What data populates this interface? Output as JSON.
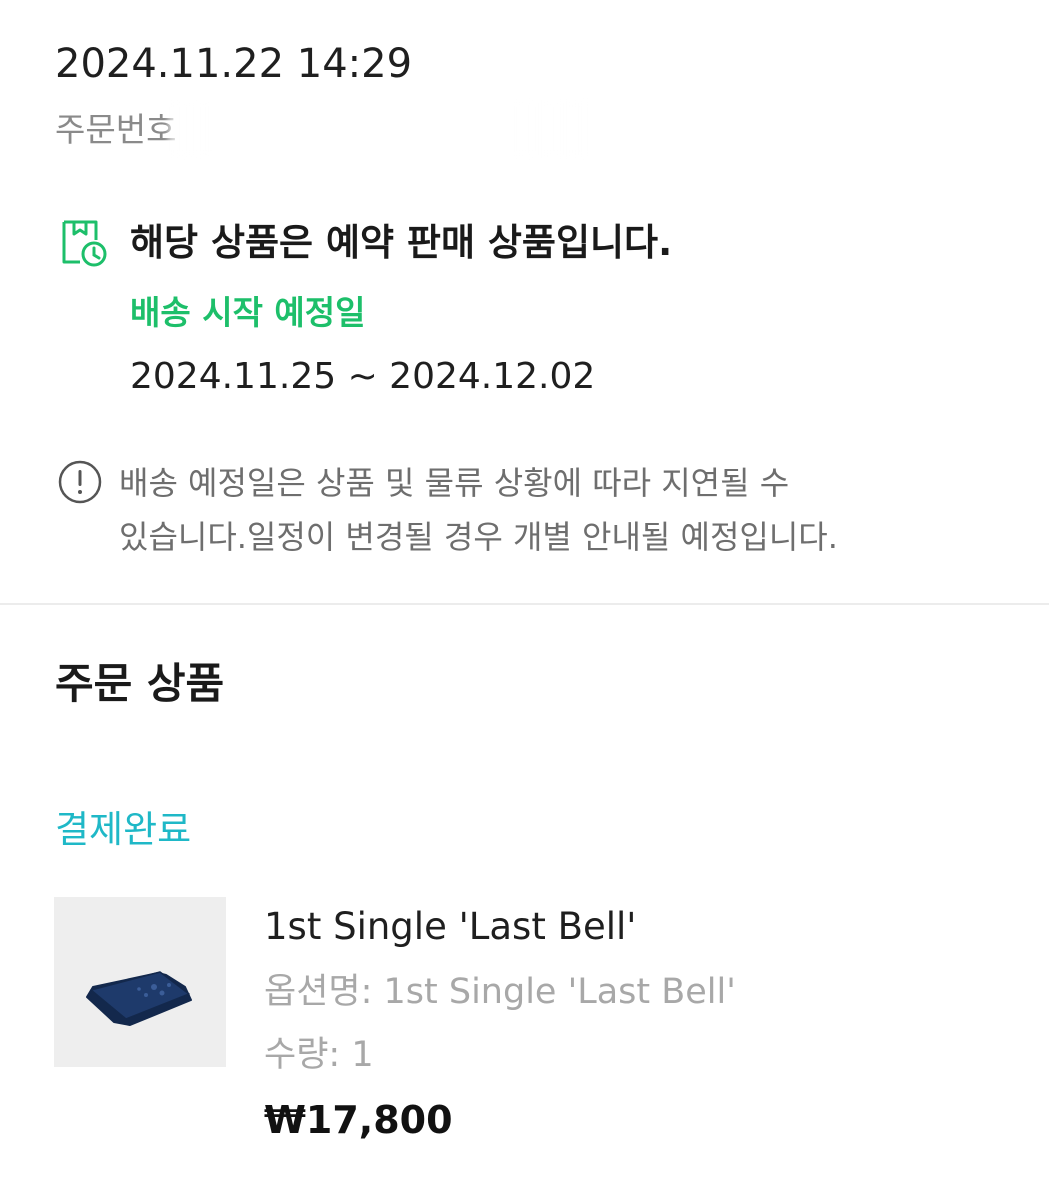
{
  "order": {
    "datetime": "2024.11.22 14:29",
    "number_label": "주문번호",
    "number_value_visible": "",
    "number_redacted": true
  },
  "preorder_notice": {
    "icon": "preorder-box-clock-icon",
    "title": "해당 상품은 예약 판매 상품입니다.",
    "ship_start_label": "배송 시작 예정일",
    "ship_range": "2024.11.25 ~ 2024.12.02"
  },
  "delay_info": {
    "icon": "info-circle-icon",
    "line1": "배송 예정일은 상품 및 물류 상황에 따라 지연될 수",
    "line2": "있습니다.일정이 변경될 경우 개별 안내될 예정입니다."
  },
  "order_items": {
    "section_title": "주문 상품",
    "status": "결제완료",
    "items": [
      {
        "thumbnail": "album-box-thumbnail",
        "name": "1st Single 'Last Bell'",
        "option": "옵션명: 1st Single 'Last Bell'",
        "quantity": "수량: 1",
        "price": "₩17,800"
      }
    ]
  },
  "colors": {
    "accent_green": "#1dbf6a",
    "status_teal": "#1fb8c7",
    "muted_text": "#a8a8a8",
    "divider": "#ececec",
    "album_navy": "#1e3a6b"
  }
}
